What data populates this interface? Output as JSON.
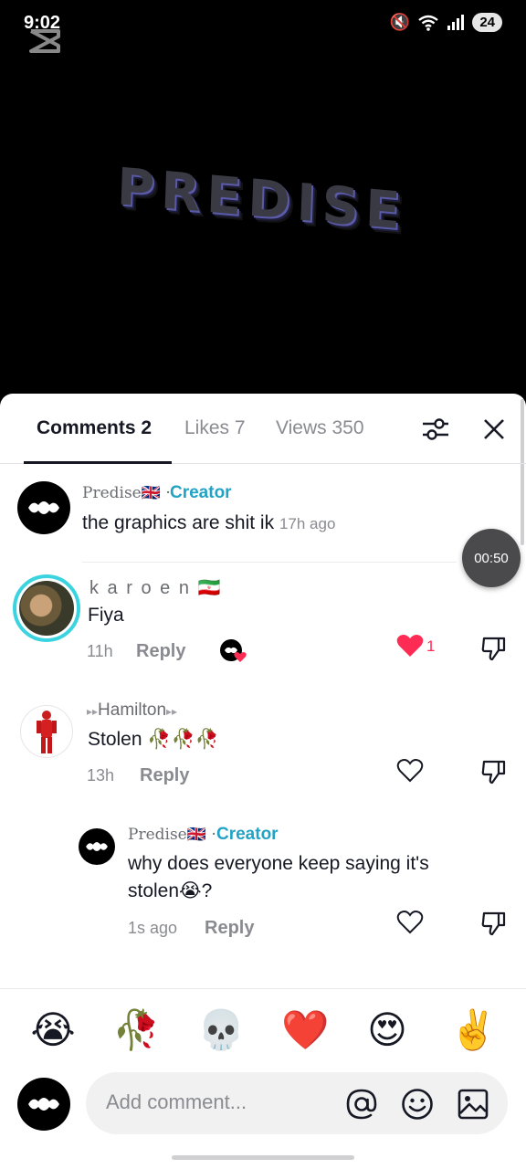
{
  "status_bar": {
    "time": "9:02",
    "battery": "24"
  },
  "video": {
    "title_text": "PREDISE"
  },
  "tabs": [
    {
      "label": "Comments 2",
      "active": true
    },
    {
      "label": "Likes 7",
      "active": false
    },
    {
      "label": "Views 350",
      "active": false
    }
  ],
  "timer": "00:50",
  "comments": [
    {
      "username": "Predise🇬🇧",
      "separator": "·",
      "badge": "Creator",
      "text": "the graphics are shit ik",
      "time": "17h ago"
    },
    {
      "username": "k a r o e n 🇮🇷",
      "text": "Fiya",
      "time": "11h",
      "reply_label": "Reply",
      "like_count": "1",
      "liked": true
    },
    {
      "username": "Hamilton",
      "text": "Stolen 🥀🥀🥀",
      "time": "13h",
      "reply_label": "Reply",
      "liked": false
    },
    {
      "username": "Predise🇬🇧",
      "separator": "·",
      "badge": "Creator",
      "text_line1": "why does everyone keep saying it's",
      "text_line2": "stolen😭?",
      "time": "1s ago",
      "reply_label": "Reply",
      "liked": false
    }
  ],
  "quick_emojis": [
    "😭",
    "🥀",
    "💀",
    "❤️",
    "😍",
    "✌️"
  ],
  "composer": {
    "placeholder": "Add comment..."
  },
  "colors": {
    "accent": "#22a3c6",
    "like": "#fe2c55"
  }
}
